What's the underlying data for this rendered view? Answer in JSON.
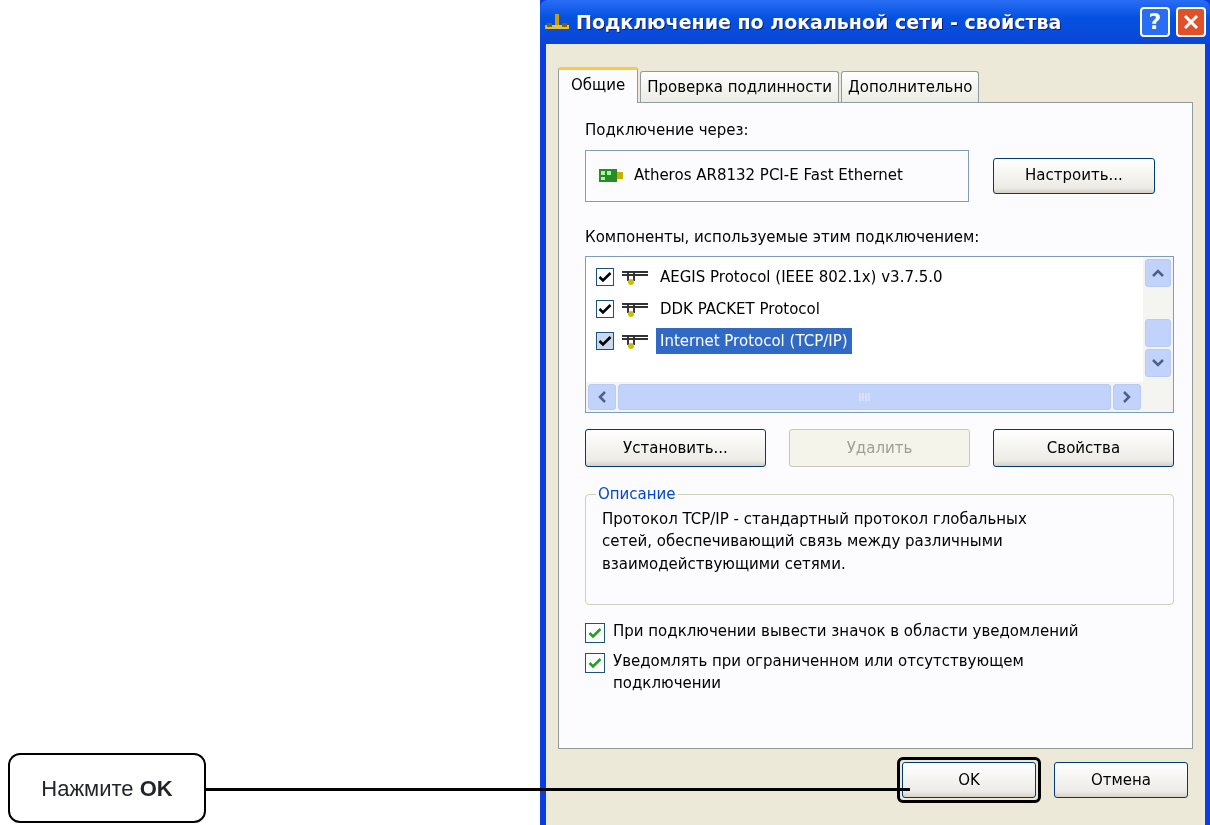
{
  "window": {
    "title": "Подключение по локальной сети - свойства",
    "help_button": "?"
  },
  "tabs": [
    {
      "label": "Общие",
      "selected": true
    },
    {
      "label": "Проверка подлинности",
      "selected": false
    },
    {
      "label": "Дополнительно",
      "selected": false
    }
  ],
  "connect_via": {
    "label": "Подключение через:",
    "adapter": "Atheros AR8132 PCI-E Fast Ethernet",
    "configure_button": "Настроить..."
  },
  "components": {
    "label": "Компоненты, используемые этим подключением:",
    "items": [
      {
        "label": "AEGIS Protocol (IEEE 802.1x) v3.7.5.0",
        "checked": true,
        "selected": false
      },
      {
        "label": "DDK PACKET Protocol",
        "checked": true,
        "selected": false
      },
      {
        "label": "Internet Protocol (TCP/IP)",
        "checked": true,
        "selected": true
      }
    ]
  },
  "component_buttons": [
    {
      "label": "Установить...",
      "disabled": false
    },
    {
      "label": "Удалить",
      "disabled": true
    },
    {
      "label": "Свойства",
      "disabled": false
    }
  ],
  "description": {
    "legend": "Описание",
    "text": "Протокол TCP/IP - стандартный протокол глобальных сетей, обеспечивающий связь между различными взаимодействующими сетями."
  },
  "options": [
    {
      "label": "При подключении вывести значок в области уведомлений",
      "checked": true
    },
    {
      "label": "Уведомлять при ограниченном или отсутствующем подключении",
      "checked": true
    }
  ],
  "footer_buttons": [
    {
      "label": "OK",
      "highlighted": true
    },
    {
      "label": "Отмена",
      "highlighted": false
    }
  ],
  "callout": {
    "text": "Нажмите **OK**"
  }
}
